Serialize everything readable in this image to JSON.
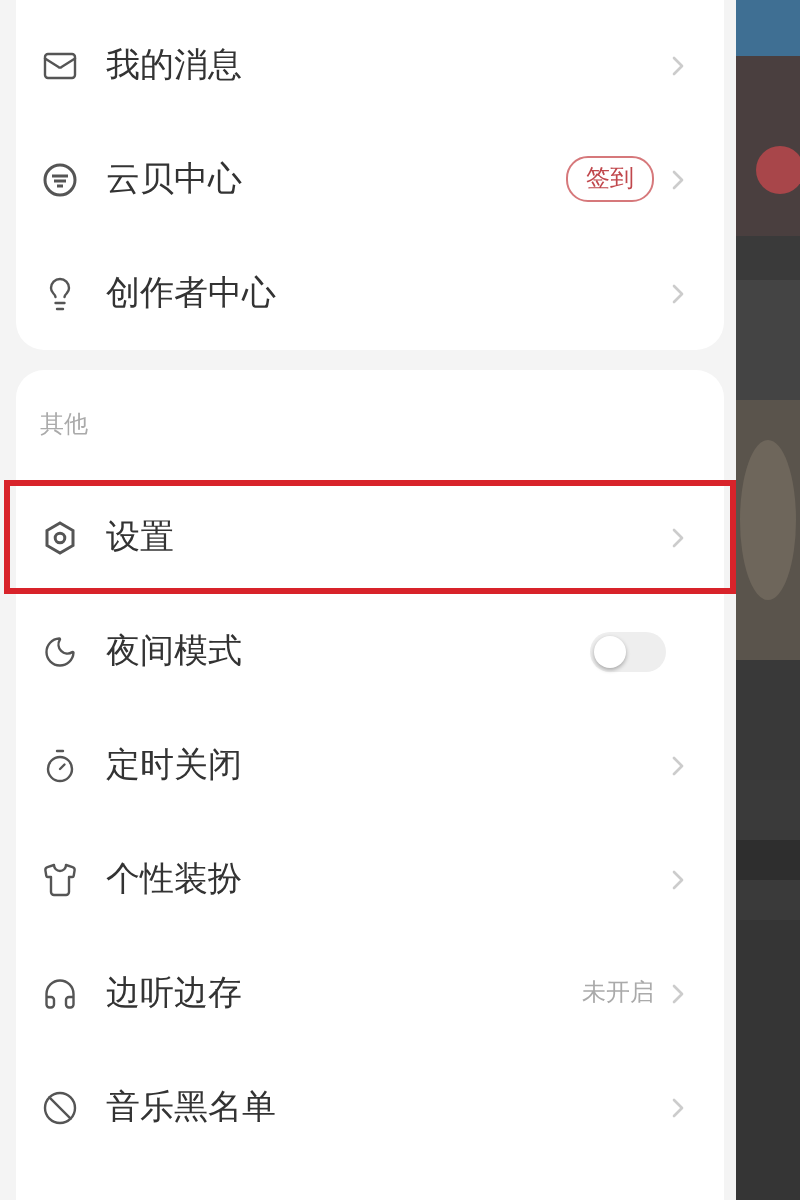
{
  "groups": [
    {
      "items": [
        {
          "kind": "chevron",
          "label": "我的消息",
          "highlighted": false
        },
        {
          "kind": "badge",
          "label": "云贝中心",
          "badge": "签到",
          "highlighted": false
        },
        {
          "kind": "chevron",
          "label": "创作者中心",
          "highlighted": false
        }
      ]
    },
    {
      "title": "其他",
      "items": [
        {
          "kind": "chevron",
          "label": "设置",
          "highlighted": true
        },
        {
          "kind": "toggle",
          "label": "夜间模式",
          "on": false,
          "highlighted": false
        },
        {
          "kind": "chevron",
          "label": "定时关闭",
          "highlighted": false
        },
        {
          "kind": "chevron",
          "label": "个性装扮",
          "highlighted": false
        },
        {
          "kind": "value",
          "label": "边听边存",
          "value": "未开启",
          "highlighted": false
        },
        {
          "kind": "chevron",
          "label": "音乐黑名单",
          "highlighted": false
        }
      ]
    }
  ]
}
